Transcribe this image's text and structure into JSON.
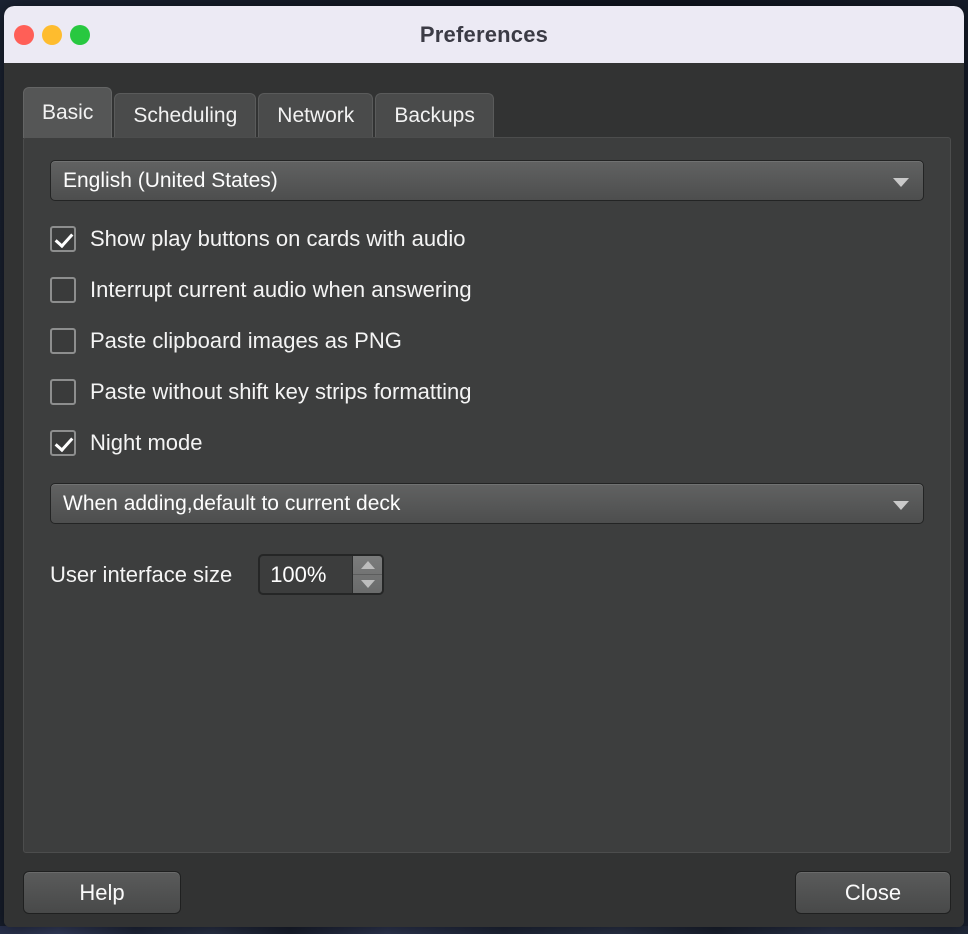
{
  "window": {
    "title": "Preferences",
    "traffic_lights": [
      {
        "name": "close",
        "color": "#ff5f57"
      },
      {
        "name": "minimize",
        "color": "#febc2e"
      },
      {
        "name": "zoom",
        "color": "#28c840"
      }
    ]
  },
  "tabs": [
    {
      "label": "Basic",
      "active": true
    },
    {
      "label": "Scheduling",
      "active": false
    },
    {
      "label": "Network",
      "active": false
    },
    {
      "label": "Backups",
      "active": false
    }
  ],
  "basic": {
    "language_combo": {
      "value": "English (United States)",
      "icon": "chevron-down-icon"
    },
    "checkboxes": [
      {
        "label": "Show play buttons on cards with audio",
        "checked": true
      },
      {
        "label": "Interrupt current audio when answering",
        "checked": false
      },
      {
        "label": "Paste clipboard images as PNG",
        "checked": false
      },
      {
        "label": "Paste without shift key strips formatting",
        "checked": false
      },
      {
        "label": "Night mode",
        "checked": true
      }
    ],
    "deck_combo": {
      "value": "When adding,default to current deck",
      "icon": "chevron-down-icon"
    },
    "ui_size": {
      "label": "User interface size",
      "value": "100%",
      "increment_icon": "triangle-up-icon",
      "decrement_icon": "triangle-down-icon"
    }
  },
  "footer": {
    "help_label": "Help",
    "close_label": "Close"
  },
  "colors": {
    "titlebar": "#eceaf4",
    "window_bg": "#323333",
    "panel_bg": "#3d3e3e",
    "tab_active": "#555656",
    "tab_inactive": "#4a4b4b",
    "text": "#f4f4f4",
    "desktop": "#141b27"
  }
}
